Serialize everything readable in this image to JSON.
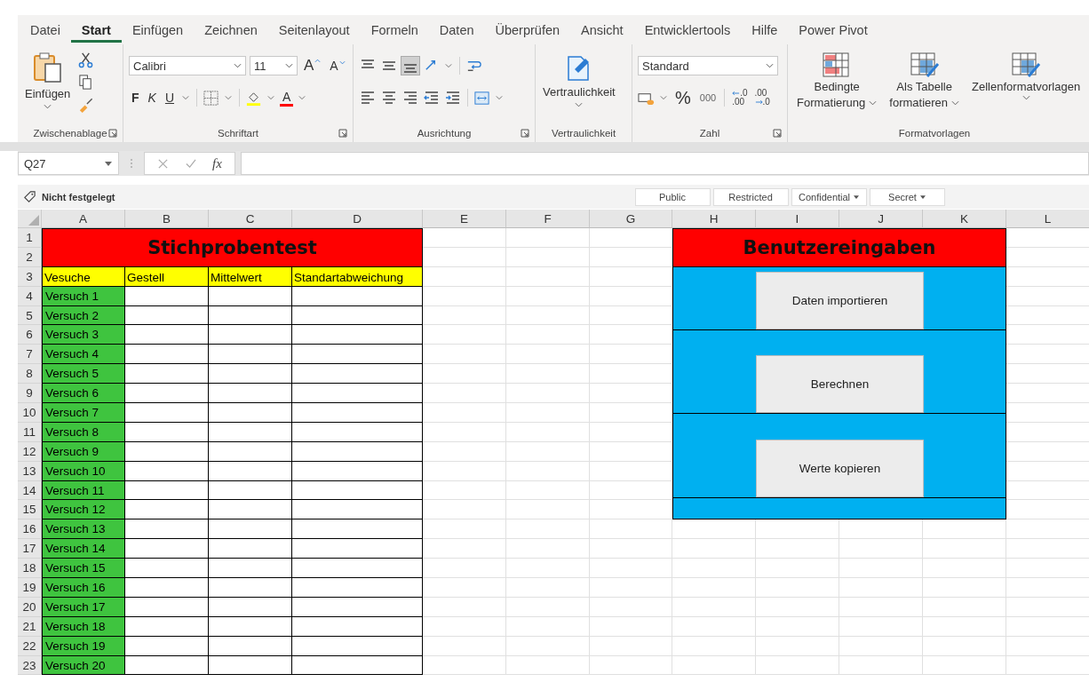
{
  "tabs": [
    {
      "label": "Datei",
      "selected": false
    },
    {
      "label": "Start",
      "selected": true
    },
    {
      "label": "Einfügen",
      "selected": false
    },
    {
      "label": "Zeichnen",
      "selected": false
    },
    {
      "label": "Seitenlayout",
      "selected": false
    },
    {
      "label": "Formeln",
      "selected": false
    },
    {
      "label": "Daten",
      "selected": false
    },
    {
      "label": "Überprüfen",
      "selected": false
    },
    {
      "label": "Ansicht",
      "selected": false
    },
    {
      "label": "Entwicklertools",
      "selected": false
    },
    {
      "label": "Hilfe",
      "selected": false
    },
    {
      "label": "Power Pivot",
      "selected": false
    }
  ],
  "ribbon": {
    "groups": [
      {
        "kind": "clipboard",
        "label": "Zwischenablage",
        "launcher": true,
        "paste": "Einfügen"
      },
      {
        "kind": "font",
        "label": "Schriftart",
        "launcher": true,
        "font": "Calibri",
        "size": "11",
        "grow": "A",
        "shrink": "A",
        "bold": "F",
        "italic": "K",
        "underline": "U",
        "font_color": "A"
      },
      {
        "kind": "alignment",
        "label": "Ausrichtung",
        "launcher": true
      },
      {
        "kind": "sensitivity",
        "label": "Vertraulichkeit",
        "launcher": false,
        "button": "Vertraulichkeit"
      },
      {
        "kind": "number",
        "label": "Zahl",
        "launcher": true,
        "format": "Standard",
        "percent": "%",
        "thousands": "000",
        "increase_decimal": [
          ".0",
          ".00"
        ],
        "decrease_decimal": [
          ".00",
          ".0"
        ]
      },
      {
        "kind": "styles",
        "label": "Formatvorlagen",
        "launcher": false,
        "buttons": [
          {
            "lines": [
              "Bedingte",
              "Formatierung"
            ]
          },
          {
            "lines": [
              "Als Tabelle",
              "formatieren"
            ]
          },
          {
            "lines": [
              "Zellenformatvorlagen"
            ]
          }
        ]
      }
    ]
  },
  "formula_bar": {
    "name_box": "Q27",
    "fx": "fx"
  },
  "sensitivity_bar": {
    "label": "Nicht festgelegt",
    "levels": [
      {
        "label": "Public",
        "dropdown": false
      },
      {
        "label": "Restricted",
        "dropdown": false
      },
      {
        "label": "Confidential",
        "dropdown": true
      },
      {
        "label": "Secret",
        "dropdown": true
      }
    ]
  },
  "sheet": {
    "columns": [
      "A",
      "B",
      "C",
      "D",
      "E",
      "F",
      "G",
      "H",
      "I",
      "J",
      "K",
      "L"
    ],
    "rows": [
      "1",
      "2",
      "3",
      "4",
      "5",
      "6",
      "7",
      "8",
      "9",
      "10",
      "11",
      "12",
      "13",
      "14",
      "15",
      "16",
      "17",
      "18",
      "19",
      "20",
      "21",
      "22",
      "23"
    ],
    "title": "Stichprobentest",
    "headers": [
      "Vesuche",
      "Gestell",
      "Mittelwert",
      "Standartabweichung"
    ],
    "trials": [
      "Versuch 1",
      "Versuch 2",
      "Versuch 3",
      "Versuch 4",
      "Versuch 5",
      "Versuch 6",
      "Versuch 7",
      "Versuch 8",
      "Versuch 9",
      "Versuch 10",
      "Versuch 11",
      "Versuch 12",
      "Versuch 13",
      "Versuch 14",
      "Versuch 15",
      "Versuch 16",
      "Versuch 17",
      "Versuch 18",
      "Versuch 19",
      "Versuch 20"
    ],
    "panel": {
      "title": "Benutzereingaben",
      "buttons": [
        "Daten importieren",
        "Berechnen",
        "Werte kopieren"
      ]
    }
  }
}
